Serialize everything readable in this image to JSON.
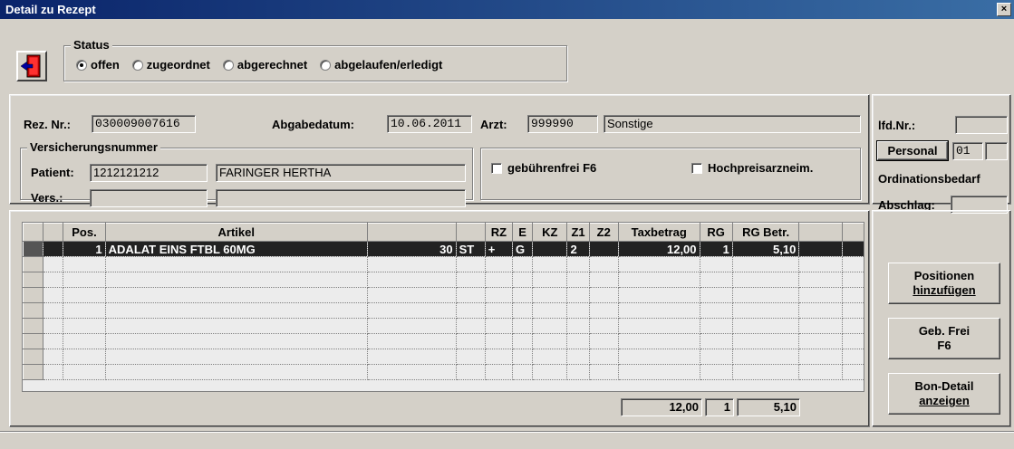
{
  "window": {
    "title": "Detail zu Rezept",
    "close": "×"
  },
  "status": {
    "title": "Status",
    "options": [
      {
        "label": "offen",
        "selected": true
      },
      {
        "label": "zugeordnet",
        "selected": false
      },
      {
        "label": "abgerechnet",
        "selected": false
      },
      {
        "label": "abgelaufen/erledigt",
        "selected": false
      }
    ]
  },
  "rezept": {
    "rez_nr_label": "Rez. Nr.:",
    "rez_nr": "030009007616",
    "abgabedatum_label": "Abgabedatum:",
    "abgabedatum": "10.06.2011",
    "arzt_label": "Arzt:",
    "arzt_nr": "999990",
    "arzt_name": "Sonstige"
  },
  "versicherung": {
    "title": "Versicherungsnummer",
    "patient_label": "Patient:",
    "patient_nr": "1212121212",
    "patient_name": "FARINGER HERTHA",
    "vers_label": "Vers.:",
    "vers_nr": "",
    "vers_name": ""
  },
  "flags": {
    "gebuehrenfrei": "gebührenfrei F6",
    "hochpreis": "Hochpreisarzneim."
  },
  "side": {
    "lfd_label": "lfd.Nr.:",
    "lfd_value": "",
    "personal_button": "Personal",
    "personal_value": "01",
    "personal_value2": "",
    "ordinationsbedarf": "Ordinationsbedarf",
    "abschlag_label": "Abschlag:",
    "abschlag_value": ""
  },
  "table": {
    "headers": [
      "",
      "Pos.",
      "Artikel",
      "",
      "",
      "RZ",
      "E",
      "KZ",
      "Z1",
      "Z2",
      "Taxbetrag",
      "RG",
      "RG Betr.",
      "",
      ""
    ],
    "rows": [
      [
        "",
        "1",
        "ADALAT EINS FTBL 60MG",
        "30",
        "ST",
        "+",
        "G",
        "",
        "2",
        "",
        "12,00",
        "1",
        "5,10",
        "",
        ""
      ]
    ],
    "totals": {
      "taxbetrag": "12,00",
      "rg": "1",
      "rg_betr": "5,10"
    }
  },
  "buttons": {
    "positionen_line1": "Positionen",
    "positionen_line2": "hinzufügen",
    "gebfrei_line1": "Geb. Frei",
    "gebfrei_line2": "F6",
    "bondetail_line1": "Bon-Detail",
    "bondetail_line2": "anzeigen"
  }
}
